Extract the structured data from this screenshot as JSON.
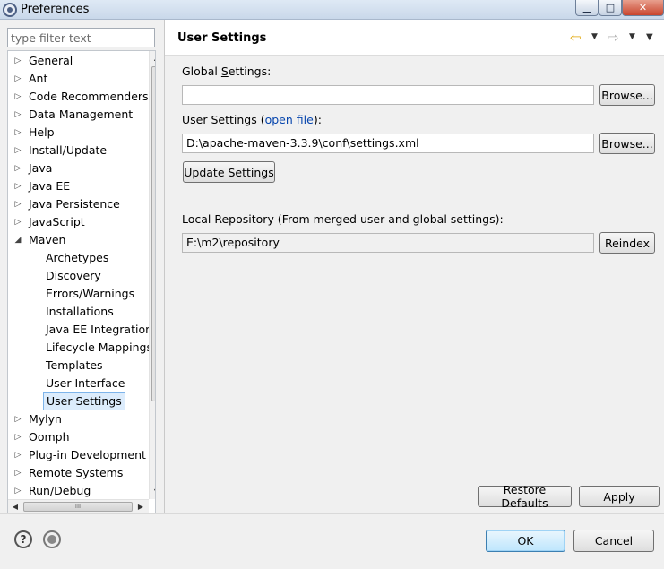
{
  "window": {
    "title": "Preferences",
    "min_glyph": "▁",
    "max_glyph": "□",
    "close_glyph": "✕"
  },
  "filter": {
    "placeholder": "type filter text"
  },
  "tree": {
    "items": [
      {
        "label": "General",
        "arrow": "▷",
        "depth": 0
      },
      {
        "label": "Ant",
        "arrow": "▷",
        "depth": 0
      },
      {
        "label": "Code Recommenders",
        "arrow": "▷",
        "depth": 0
      },
      {
        "label": "Data Management",
        "arrow": "▷",
        "depth": 0
      },
      {
        "label": "Help",
        "arrow": "▷",
        "depth": 0
      },
      {
        "label": "Install/Update",
        "arrow": "▷",
        "depth": 0
      },
      {
        "label": "Java",
        "arrow": "▷",
        "depth": 0
      },
      {
        "label": "Java EE",
        "arrow": "▷",
        "depth": 0
      },
      {
        "label": "Java Persistence",
        "arrow": "▷",
        "depth": 0
      },
      {
        "label": "JavaScript",
        "arrow": "▷",
        "depth": 0
      },
      {
        "label": "Maven",
        "arrow": "◢",
        "depth": 0
      },
      {
        "label": "Archetypes",
        "arrow": "",
        "depth": 1
      },
      {
        "label": "Discovery",
        "arrow": "",
        "depth": 1
      },
      {
        "label": "Errors/Warnings",
        "arrow": "",
        "depth": 1
      },
      {
        "label": "Installations",
        "arrow": "",
        "depth": 1
      },
      {
        "label": "Java EE Integration",
        "arrow": "",
        "depth": 1
      },
      {
        "label": "Lifecycle Mappings",
        "arrow": "",
        "depth": 1
      },
      {
        "label": "Templates",
        "arrow": "",
        "depth": 1
      },
      {
        "label": "User Interface",
        "arrow": "",
        "depth": 1
      },
      {
        "label": "User Settings",
        "arrow": "",
        "depth": 1,
        "selected": true
      },
      {
        "label": "Mylyn",
        "arrow": "▷",
        "depth": 0
      },
      {
        "label": "Oomph",
        "arrow": "▷",
        "depth": 0
      },
      {
        "label": "Plug-in Development",
        "arrow": "▷",
        "depth": 0
      },
      {
        "label": "Remote Systems",
        "arrow": "▷",
        "depth": 0
      },
      {
        "label": "Run/Debug",
        "arrow": "▷",
        "depth": 0
      }
    ],
    "scroll_up_glyph": "▲",
    "scroll_down_glyph": "▼",
    "scroll_left_glyph": "◀",
    "scroll_right_glyph": "▶",
    "grip_glyph": "≡",
    "hgrip_glyph": "III"
  },
  "page": {
    "title": "User Settings",
    "back_glyph": "⇦",
    "forward_glyph": "⇨",
    "menu_glyph": "▼",
    "view_menu_glyph": "▼",
    "global_settings": {
      "label_pre": "Global ",
      "label_mn": "S",
      "label_post": "ettings:",
      "value": "",
      "browse_label": "Browse..."
    },
    "user_settings": {
      "label_pre": "User ",
      "label_mn": "S",
      "label_post": "ettings (",
      "link": "open file",
      "label_end": "):",
      "value": "D:\\apache-maven-3.3.9\\conf\\settings.xml",
      "browse_label": "Browse...",
      "update_label": "Update Settings"
    },
    "local_repo": {
      "label": "Local Repository (From merged user and global settings):",
      "value": "E:\\m2\\repository",
      "reindex_label": "Reindex"
    },
    "restore_defaults_label": "Restore Defaults",
    "apply_label": "Apply"
  },
  "footer": {
    "help_glyph": "?",
    "ok_label": "OK",
    "cancel_label": "Cancel"
  },
  "colors": {
    "selection_bg": "#dcecfc",
    "selection_border": "#7eb4ea",
    "link": "#0645ad",
    "back_arrow": "#e0a400"
  }
}
